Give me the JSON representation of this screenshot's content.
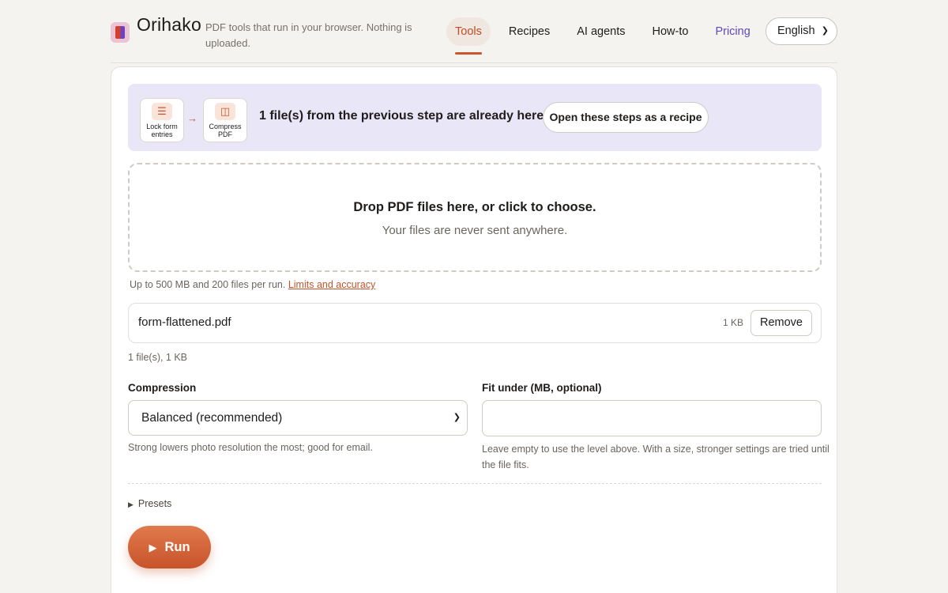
{
  "header": {
    "brand": "Orihako",
    "tagline": "PDF tools that run in your browser. Nothing is uploaded.",
    "nav": [
      {
        "label": "Tools",
        "active": true
      },
      {
        "label": "Recipes"
      },
      {
        "label": "AI agents"
      },
      {
        "label": "How-to"
      },
      {
        "label": "Pricing"
      }
    ],
    "language": "English"
  },
  "banner": {
    "steps": [
      {
        "label": "Lock form entries",
        "icon": "layers-icon"
      },
      {
        "label": "Compress PDF",
        "icon": "compress-icon"
      }
    ],
    "message": "1 file(s) from the previous step are already here.",
    "recipe_button": "Open these steps as a recipe"
  },
  "dropzone": {
    "title": "Drop PDF files here, or click to choose.",
    "subtitle": "Your files are never sent anywhere."
  },
  "limits": {
    "text": "Up to 500 MB and 200 files per run.",
    "link": "Limits and accuracy"
  },
  "files": [
    {
      "name": "form-flattened.pdf",
      "size": "1 KB",
      "remove_label": "Remove"
    }
  ],
  "summary": "1 file(s), 1 KB",
  "compression": {
    "label": "Compression",
    "value": "Balanced (recommended)",
    "hint": "Strong lowers photo resolution the most; good for email."
  },
  "fit_under": {
    "label": "Fit under (MB, optional)",
    "value": "",
    "hint": "Leave empty to use the level above. With a size, stronger settings are tried until the file fits."
  },
  "presets_label": "Presets",
  "run_label": "Run",
  "colors": {
    "accent": "#c9562e",
    "banner_bg": "#e9e6f8",
    "pricing": "#5c4bb8"
  }
}
